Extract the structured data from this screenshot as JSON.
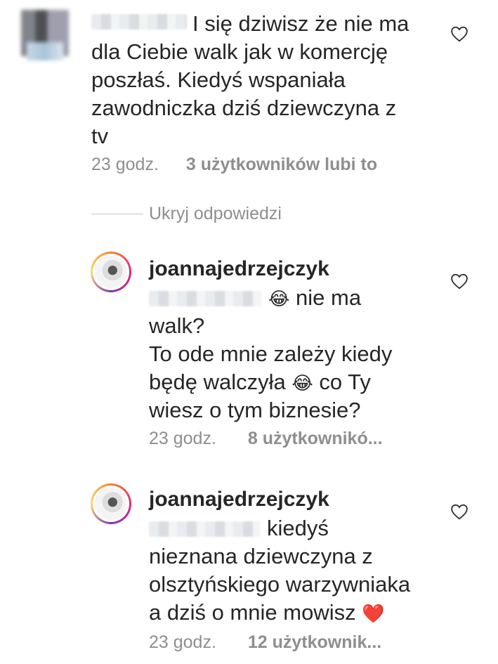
{
  "comment1": {
    "text": "I się dziwisz że nie ma\ndla Ciebie walk jak w komercję\nposzłaś. Kiedyś wspaniała\nzawodniczka dziś dziewczyna z\ntv",
    "time": "23 godz.",
    "likes": "3 użytkowników lubi to",
    "heart_icon": "heart-outline-icon"
  },
  "hide_replies": "Ukryj odpowiedzi",
  "reply1": {
    "username": "joannajedrzejczyk",
    "text_a": "nie ma",
    "text_b": "walk?\nTo ode mnie zależy kiedy",
    "text_c": "będę walczyła",
    "text_d": "co Ty",
    "text_e": "wiesz o tym biznesie?",
    "emoji": "😂",
    "time": "23 godz.",
    "likes": "8 użytkownikó...",
    "heart_icon": "heart-outline-icon"
  },
  "reply2": {
    "username": "joannajedrzejczyk",
    "text_a": "kiedyś",
    "text_b": "nieznana dziewczyna z\nolsztyńskiego warzywniaka",
    "text_c": "a dziś o mnie mowisz",
    "emoji": "❤️",
    "time": "23 godz.",
    "likes": "12 użytkownik...",
    "heart_icon": "heart-outline-icon"
  }
}
